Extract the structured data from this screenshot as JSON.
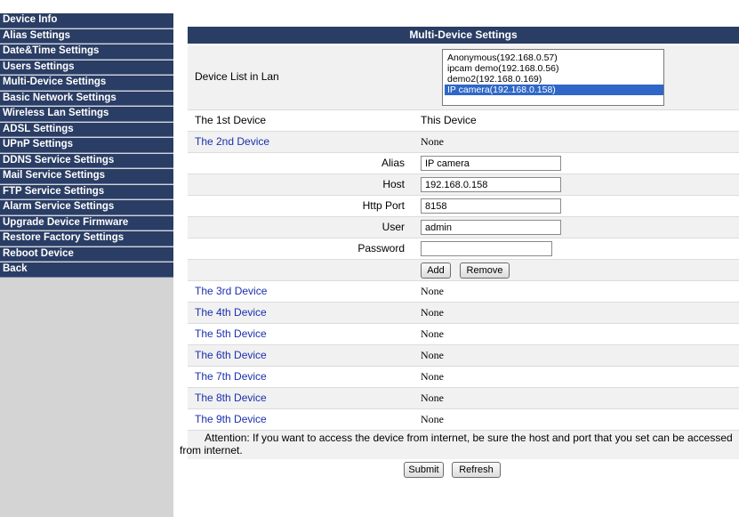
{
  "sidebar": {
    "items": [
      "Device Info",
      "Alias Settings",
      "Date&Time Settings",
      "Users Settings",
      "Multi-Device Settings",
      "Basic Network Settings",
      "Wireless Lan Settings",
      "ADSL Settings",
      "UPnP Settings",
      "DDNS Service Settings",
      "Mail Service Settings",
      "FTP Service Settings",
      "Alarm Service Settings",
      "Upgrade Device Firmware",
      "Restore Factory Settings",
      "Reboot Device",
      "Back"
    ]
  },
  "panel": {
    "title": "Multi-Device Settings",
    "device_list_label": "Device List in Lan",
    "device_list": [
      "Anonymous(192.168.0.57)",
      "ipcam demo(192.168.0.56)",
      "demo2(192.168.0.169)",
      "IP camera(192.168.0.158)"
    ],
    "first_device_label": "The 1st Device",
    "first_device_value": "This Device",
    "second_device_label": "The 2nd Device",
    "second_device_value": "None",
    "fields": {
      "alias_label": "Alias",
      "alias_value": "IP camera",
      "host_label": "Host",
      "host_value": "192.168.0.158",
      "port_label": "Http Port",
      "port_value": "8158",
      "user_label": "User",
      "user_value": "admin",
      "password_label": "Password",
      "password_value": ""
    },
    "add_label": "Add",
    "remove_label": "Remove",
    "other_devices": [
      {
        "label": "The 3rd Device",
        "value": "None"
      },
      {
        "label": "The 4th Device",
        "value": "None"
      },
      {
        "label": "The 5th Device",
        "value": "None"
      },
      {
        "label": "The 6th Device",
        "value": "None"
      },
      {
        "label": "The 7th Device",
        "value": "None"
      },
      {
        "label": "The 8th Device",
        "value": "None"
      },
      {
        "label": "The 9th Device",
        "value": "None"
      }
    ],
    "attention": "Attention: If you want to access the device from internet, be sure the host and port that you set can be accessed from internet.",
    "submit_label": "Submit",
    "refresh_label": "Refresh"
  }
}
